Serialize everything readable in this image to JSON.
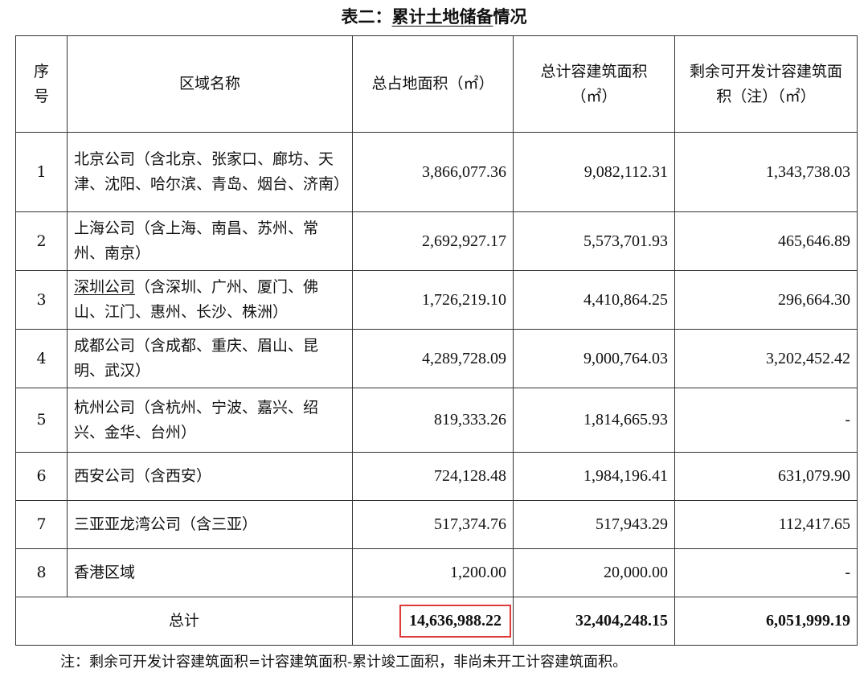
{
  "table_title_part1": "表二：",
  "table_title_part2": "累计土地储备",
  "table_title_part3": "情况",
  "headers": {
    "seq": "序号",
    "region": "区域名称",
    "land_area": "总占地面积（㎡）",
    "gfa": "总计容建筑面积（㎡）",
    "remaining": "剩余可开发计容建筑面积（注）（㎡）"
  },
  "rows": [
    {
      "seq": "1",
      "region": "北京公司（含北京、张家口、廊坊、天津、沈阳、哈尔滨、青岛、烟台、济南）",
      "land_area": "3,866,077.36",
      "gfa": "9,082,112.31",
      "remaining": "1,343,738.03"
    },
    {
      "seq": "2",
      "region": "上海公司（含上海、南昌、苏州、常州、南京）",
      "land_area": "2,692,927.17",
      "gfa": "5,573,701.93",
      "remaining": "465,646.89"
    },
    {
      "seq": "3",
      "region_a": "深圳公司",
      "region_b": "（含深圳、广州、厦门、佛山、江门、惠州、长沙、株洲）",
      "land_area": "1,726,219.10",
      "gfa": "4,410,864.25",
      "remaining": "296,664.30"
    },
    {
      "seq": "4",
      "region": "成都公司（含成都、重庆、眉山、昆明、武汉）",
      "land_area": "4,289,728.09",
      "gfa": "9,000,764.03",
      "remaining": "3,202,452.42"
    },
    {
      "seq": "5",
      "region": "杭州公司（含杭州、宁波、嘉兴、绍兴、金华、台州）",
      "land_area": "819,333.26",
      "gfa": "1,814,665.93",
      "remaining": "-"
    },
    {
      "seq": "6",
      "region": "西安公司（含西安）",
      "land_area": "724,128.48",
      "gfa": "1,984,196.41",
      "remaining": "631,079.90"
    },
    {
      "seq": "7",
      "region": "三亚亚龙湾公司（含三亚）",
      "land_area": "517,374.76",
      "gfa": "517,943.29",
      "remaining": "112,417.65"
    },
    {
      "seq": "8",
      "region": "香港区域",
      "land_area": "1,200.00",
      "gfa": "20,000.00",
      "remaining": "-"
    }
  ],
  "total": {
    "label": "总计",
    "land_area": "14,636,988.22",
    "gfa": "32,404,248.15",
    "remaining": "6,051,999.19"
  },
  "note": "注：剩余可开发计容建筑面积=计容建筑面积-累计竣工面积，非尚未开工计容建筑面积。",
  "colors": {
    "highlight_box": "#e0393a",
    "border": "#333333"
  }
}
